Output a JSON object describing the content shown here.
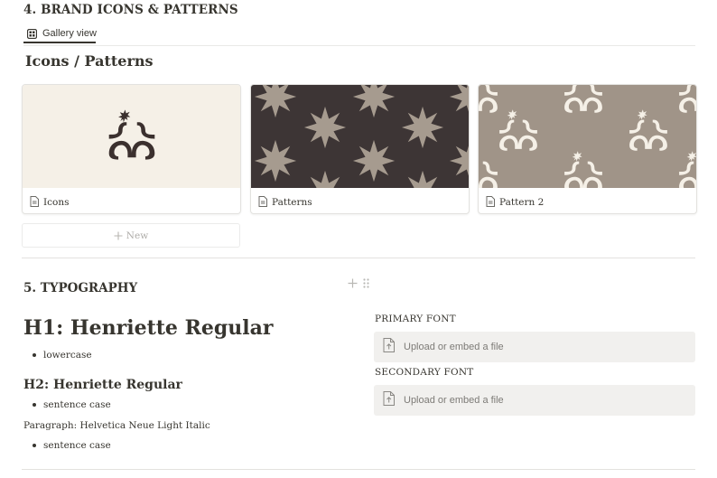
{
  "section4": {
    "heading": "4. BRAND ICONS & PATTERNS",
    "view_tab": {
      "label": "Gallery view",
      "icon": "gallery-grid-icon"
    },
    "gallery_title": "Icons / Patterns",
    "cards": [
      {
        "title": "Icons",
        "cover_color": "#f5f0e7",
        "mark_color": "#3b302e"
      },
      {
        "title": "Patterns",
        "cover_color": "#3d3535",
        "mark_color": "#a69b8f"
      },
      {
        "title": "Pattern 2",
        "cover_color": "#a09488",
        "mark_color": "#f5f0e7"
      }
    ],
    "new_button_label": "New"
  },
  "section5": {
    "heading": "5. TYPOGRAPHY",
    "h1_sample": "H1: Henriette Regular",
    "h1_case": "lowercase",
    "h2_sample": "H2: Henriette Regular",
    "h2_case": "sentence case",
    "paragraph_sample": "Paragraph: Helvetica Neue Light Italic",
    "paragraph_case": "sentence case",
    "primary_font_label": "PRIMARY FONT",
    "secondary_font_label": "SECONDARY FONT",
    "upload_label": "Upload or embed a file"
  },
  "colors": {
    "text": "#37352f",
    "upload_background": "#f1f0ee",
    "divider": "#e3e2df"
  }
}
